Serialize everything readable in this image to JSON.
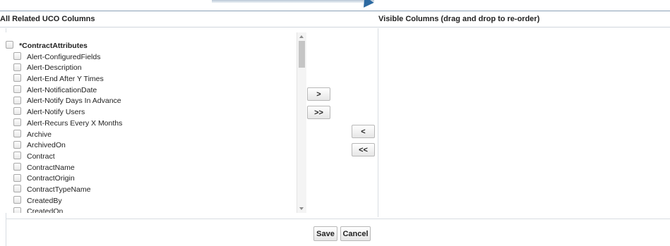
{
  "headers": {
    "left": "All Related UCO Columns",
    "right": "Visible Columns (drag and drop to re-order)"
  },
  "available_columns": {
    "group_label": "*ContractAttributes",
    "items": [
      "Alert-ConfiguredFields",
      "Alert-Description",
      "Alert-End After Y Times",
      "Alert-NotificationDate",
      "Alert-Notify Days In Advance",
      "Alert-Notify Users",
      "Alert-Recurs Every X Months",
      "Archive",
      "ArchivedOn",
      "Contract",
      "ContractName",
      "ContractOrigin",
      "ContractTypeName",
      "CreatedBy",
      "CreatedOn"
    ]
  },
  "transfer_buttons": {
    "add": ">",
    "add_all": ">>",
    "remove": "<",
    "remove_all": "<<"
  },
  "footer": {
    "save": "Save",
    "cancel": "Cancel"
  },
  "colors": {
    "accent_arrow": "#2d6aa1",
    "border": "#d8dde2"
  }
}
